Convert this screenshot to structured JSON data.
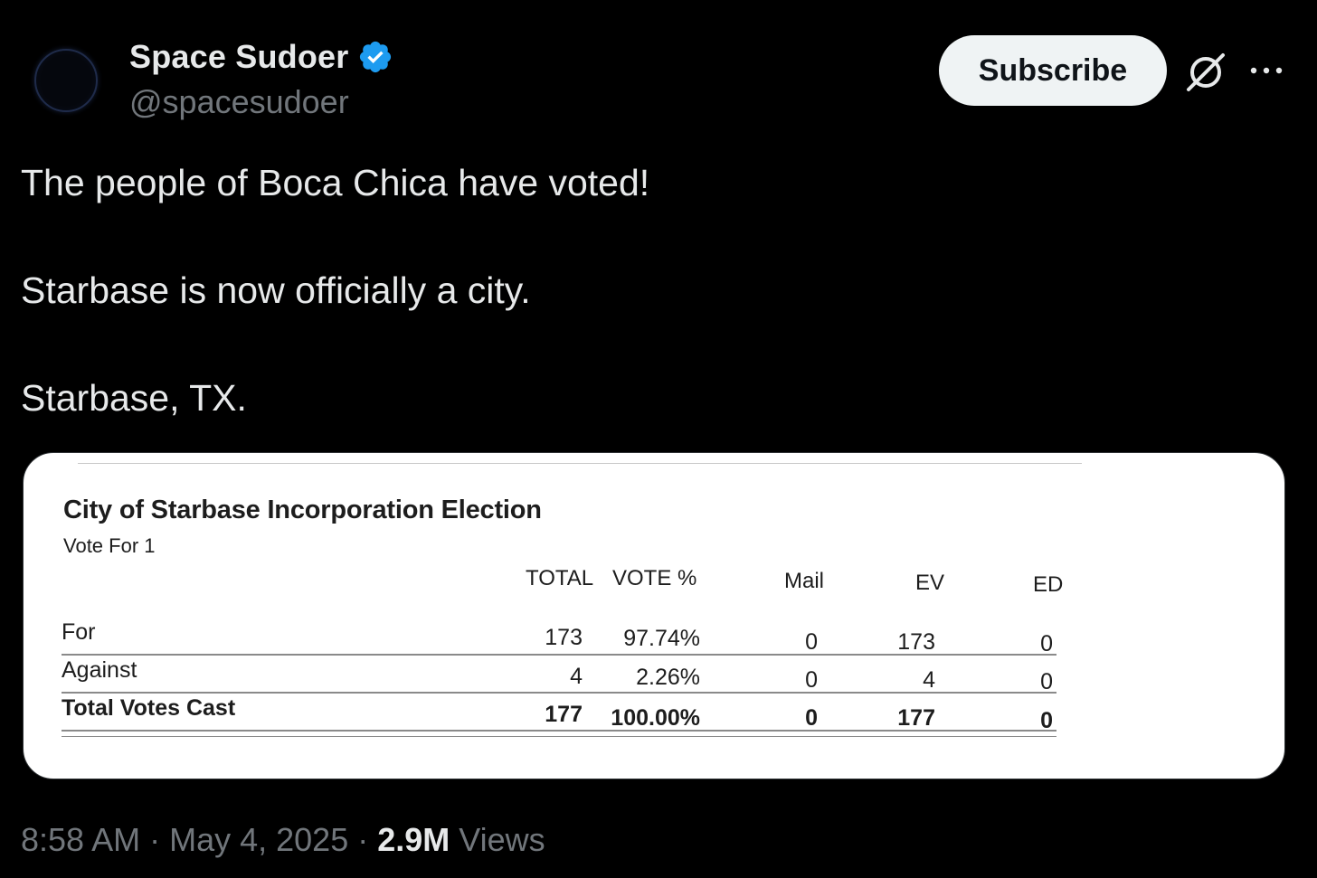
{
  "author": {
    "display_name": "Space Sudoer",
    "handle": "@spacesudoer",
    "verified_color": "#1d9bf0"
  },
  "actions": {
    "subscribe_label": "Subscribe",
    "grok_icon": "grok-icon",
    "more_icon": "more-icon"
  },
  "tweet": {
    "lines": [
      "The people of Boca Chica have voted!",
      "Starbase is now officially a city.",
      "Starbase, TX."
    ]
  },
  "media": {
    "title": "City of Starbase Incorporation Election",
    "subtitle": "Vote For 1",
    "columns": [
      "TOTAL",
      "VOTE %",
      "Mail",
      "EV",
      "ED"
    ],
    "rows": [
      {
        "label": "For",
        "total": "173",
        "pct": "97.74%",
        "mail": "0",
        "ev": "173",
        "ed": "0"
      },
      {
        "label": "Against",
        "total": "4",
        "pct": "2.26%",
        "mail": "0",
        "ev": "4",
        "ed": "0"
      },
      {
        "label": "Total Votes Cast",
        "total": "177",
        "pct": "100.00%",
        "mail": "0",
        "ev": "177",
        "ed": "0"
      }
    ]
  },
  "footer": {
    "time": "8:58 AM",
    "sep1": " · ",
    "date": "May 4, 2025",
    "sep2": " · ",
    "views_count": "2.9M",
    "views_label": " Views"
  },
  "colors": {
    "background": "#000000",
    "text_primary": "#e7e9ea",
    "text_secondary": "#71767b",
    "subscribe_bg": "#eff3f4"
  }
}
